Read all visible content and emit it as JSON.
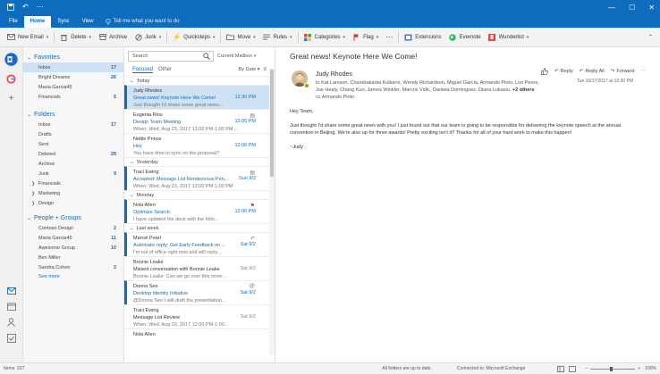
{
  "ribbon": {
    "tabs": [
      "File",
      "Home",
      "Sync",
      "View"
    ],
    "tell_me": "Tell me what you want to do"
  },
  "toolbar": {
    "new_email": "New Email",
    "delete": "Delete",
    "archive": "Archive",
    "junk": "Junk",
    "quicksteps": "Quicksteps",
    "move": "Move",
    "rules": "Rules",
    "categories": "Categories",
    "flag": "Flag",
    "extensions": "Extensions",
    "evernote": "Evernote",
    "wunderlist": "Wunderlist"
  },
  "folders": {
    "favorites_header": "Favorites",
    "favorites": [
      {
        "label": "Inbox",
        "count": "17"
      },
      {
        "label": "Bright Dreams",
        "count": "26"
      },
      {
        "label": "Maria Garcia45",
        "count": ""
      },
      {
        "label": "Financials",
        "count": "5"
      }
    ],
    "folders_header": "Folders",
    "folders": [
      {
        "label": "Inbox",
        "count": "17"
      },
      {
        "label": "Drafts",
        "count": ""
      },
      {
        "label": "Sent",
        "count": ""
      },
      {
        "label": "Deleted",
        "count": "29"
      },
      {
        "label": "Archive",
        "count": ""
      },
      {
        "label": "Junk",
        "count": "9"
      },
      {
        "label": "Financials",
        "count": ""
      },
      {
        "label": "Marketing",
        "count": ""
      },
      {
        "label": "Design",
        "count": ""
      }
    ],
    "groups_header": "People + Groups",
    "groups": [
      {
        "label": "Contoso Design",
        "count": "2"
      },
      {
        "label": "Maria Garcia45",
        "count": "11"
      },
      {
        "label": "Awesome Group",
        "count": "10"
      },
      {
        "label": "Ben Miller",
        "count": ""
      },
      {
        "label": "Sandra Cohen",
        "count": "2"
      }
    ],
    "see_more": "See more"
  },
  "message_list": {
    "search_placeholder": "Search",
    "scope": "Current Mailbox",
    "focused": "Focused",
    "other": "Other",
    "sort": "By Date",
    "groups": {
      "today": "Today",
      "yesterday": "Yesterday",
      "monday": "Monday",
      "last_week": "Last week"
    },
    "messages": [
      {
        "from": "Judy Rhodes",
        "subject": "Great news! Keynote Here We Come!",
        "time": "12:30 PM",
        "preview": "Just thought I'd share some great news..."
      },
      {
        "from": "Eugenia Rios",
        "subject": "Design Team Meeting",
        "time": "12:00 PM",
        "preview": "When: Wed, Aug 23, 2017 12:00 PM-1:00 PM..."
      },
      {
        "from": "Nettie Prince",
        "subject": "Hey",
        "time": "12:00 PM",
        "preview": "You have time to sync on the proposal?"
      },
      {
        "from": "Traci Ewing",
        "subject": "Accepted: Message List Rendezvous Pen...",
        "time": "Sun 9/2",
        "preview": "When: Wed, Aug 23, 2017 12:00 PM-1:00 PM"
      },
      {
        "from": "Nola Allen",
        "subject": "Optimize Search",
        "time": "12:00 PM",
        "preview": "I have updated the deck with the follo..."
      },
      {
        "from": "Marcel Pearl",
        "subject": "Automatic reply: Get Early Feedback on ...",
        "time": "Sat 9/2",
        "preview": "I'm out of office right now and will reply..."
      },
      {
        "from": "Bonnie Leake",
        "subject": "Missed conversation with Bonnie Leake",
        "time": "Sat 9/2",
        "preview": "Bonnie Leake: Can we go over this more..."
      },
      {
        "from": "Donna Seo",
        "subject": "Desktop Identity Initiative",
        "time": "Sat 9/2",
        "preview": "@Donna Seo I will draft the presentation..."
      },
      {
        "from": "Traci Ewing",
        "subject": "Message List Review",
        "time": "Sat 9/2",
        "preview": "When: Wed, Aug 23, 2017 12:00 PM-1:00..."
      },
      {
        "from": "Nola Allen",
        "subject": "",
        "time": "",
        "preview": ""
      }
    ]
  },
  "reading": {
    "subject": "Great news! Keynote Here We Come!",
    "sender": "Judy Rhodes",
    "to_label": "to",
    "recipients_1": "Kat Larsson, Chandrakanta Kulkarni, Wendy Richardson, Miguel Garcia, Armando Pinto, Lori Peres,",
    "recipients_2": "Joe Healy, Chang Kuo, James Winkler, Marcos Vidic, Daniela Dominguez, Diana Lukasiu,",
    "more": "+2 others",
    "cc_label": "cc",
    "cc": "Armando Pinto",
    "date": "Tue 10/17/2017 at 12:30 PM",
    "reply": "Reply",
    "reply_all": "Reply All",
    "forward": "Forward",
    "greeting": "Hey Team,",
    "body": "Just thought I'd share some great news with you! I just found out that our team is going to be responsible for delivering the keynote speech at the annual convention in Beijing. We're also up for three awards! Pretty exciting isn't it? Thanks for all of your hard work to make this happen!",
    "signoff": "~Judy"
  },
  "status": {
    "items": "Items: 227",
    "sync": "All folders are up to date.",
    "connected": "Connected to: Microsoft Exchange",
    "zoom": "100%"
  }
}
